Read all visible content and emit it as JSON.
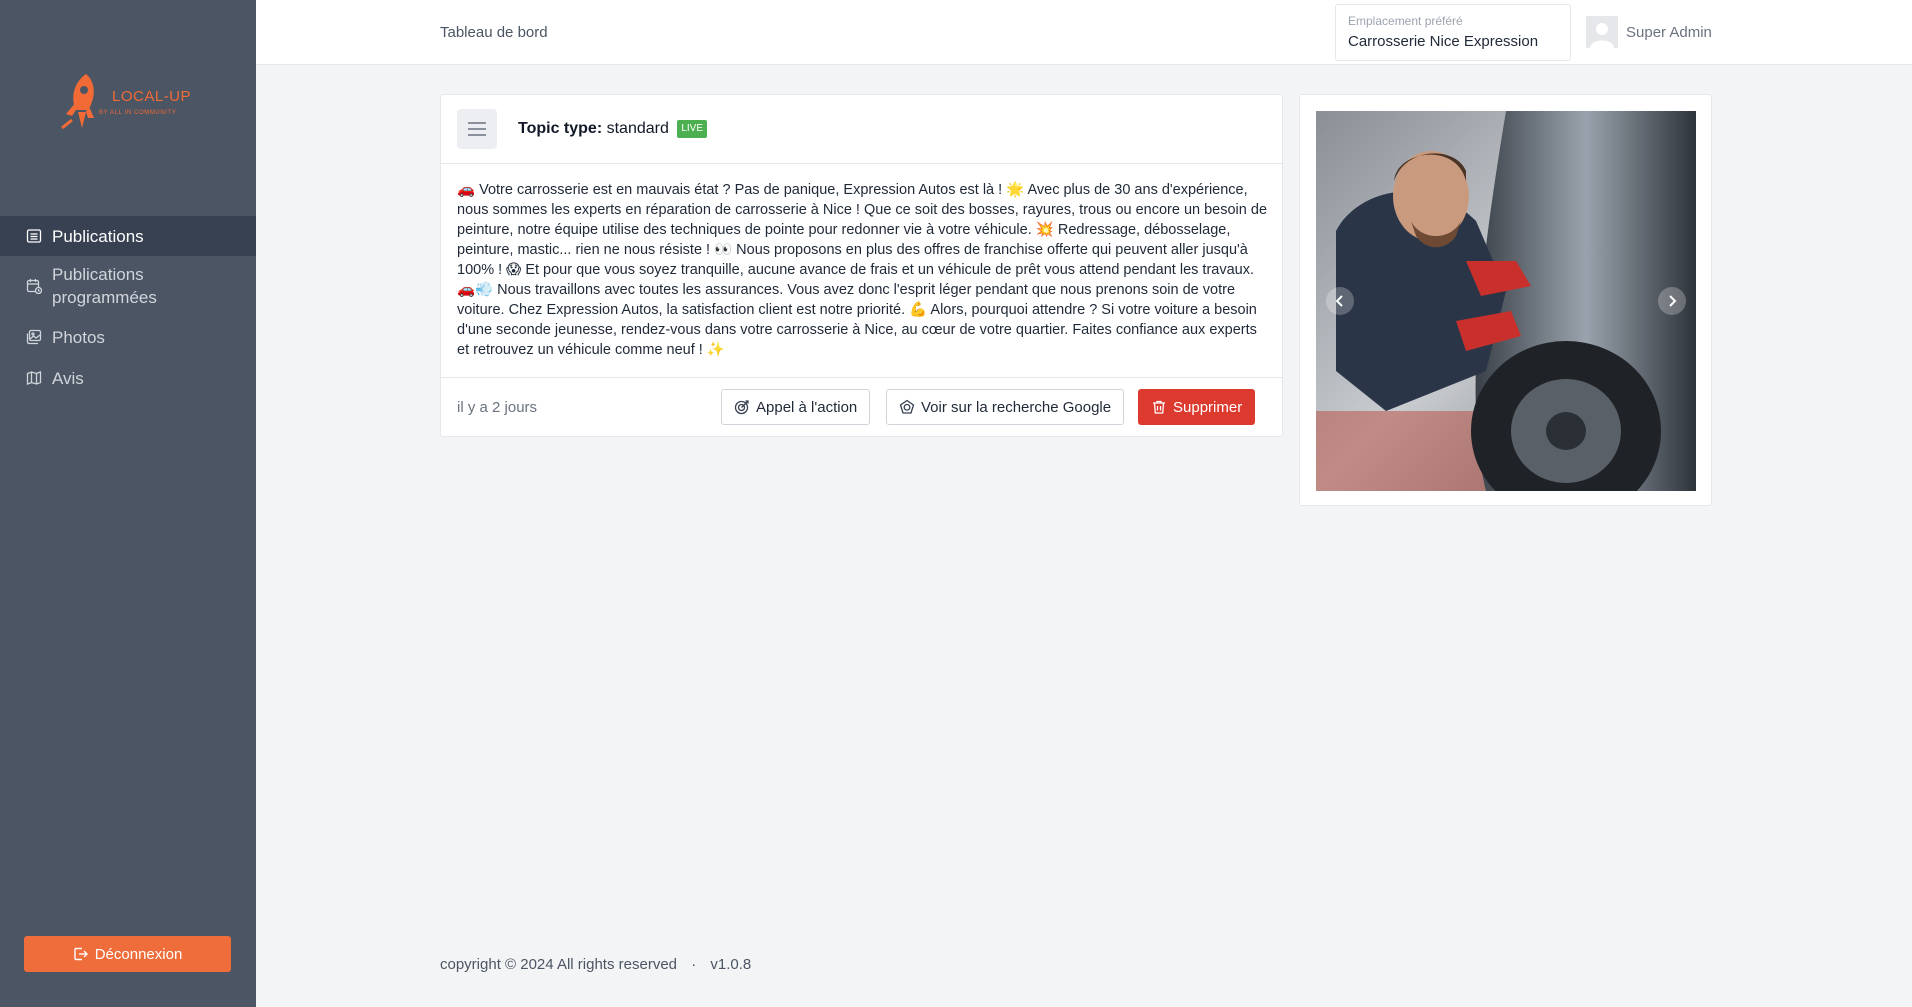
{
  "brand": {
    "name": "LOCAL-UP",
    "tagline": "BY ALL IN COMMUNITY",
    "accent": "#f26a35"
  },
  "sidebar": {
    "items": [
      {
        "label": "Publications",
        "icon": "list-icon",
        "active": true
      },
      {
        "label": "Publications programmées",
        "icon": "calendar-icon",
        "active": false
      },
      {
        "label": "Photos",
        "icon": "images-icon",
        "active": false
      },
      {
        "label": "Avis",
        "icon": "map-icon",
        "active": false
      }
    ],
    "logout_label": "Déconnexion"
  },
  "header": {
    "breadcrumb": "Tableau de bord",
    "location_label": "Emplacement préféré",
    "location_value": "Carrosserie Nice Expression",
    "user_name": "Super Admin"
  },
  "post": {
    "topic_label": "Topic type:",
    "topic_value": "standard",
    "status_badge": "LIVE",
    "body": "🚗 Votre carrosserie est en mauvais état ? Pas de panique, Expression Autos est là ! 🌟 Avec plus de 30 ans d'expérience, nous sommes les experts en réparation de carrosserie à Nice ! Que ce soit des bosses, rayures, trous ou encore un besoin de peinture, notre équipe utilise des techniques de pointe pour redonner vie à votre véhicule. 💥 Redressage, débosselage, peinture, mastic... rien ne nous résiste ! 👀 Nous proposons en plus des offres de franchise offerte qui peuvent aller jusqu'à 100% ! 😱 Et pour que vous soyez tranquille, aucune avance de frais et un véhicule de prêt vous attend pendant les travaux. 🚗💨 Nous travaillons avec toutes les assurances. Vous avez donc l'esprit léger pendant que nous prenons soin de votre voiture. Chez Expression Autos, la satisfaction client est notre priorité. 💪 Alors, pourquoi attendre ? Si votre voiture a besoin d'une seconde jeunesse, rendez-vous dans votre carrosserie à Nice, au cœur de votre quartier. Faites confiance aux experts et retrouvez un véhicule comme neuf ! ✨",
    "time_ago": "il y a 2 jours",
    "cta_label": "Appel à l'action",
    "google_label": "Voir sur la recherche Google",
    "delete_label": "Supprimer"
  },
  "footer": {
    "copyright": "copyright © 2024 All rights reserved",
    "separator": "·",
    "version": "v1.0.8"
  }
}
